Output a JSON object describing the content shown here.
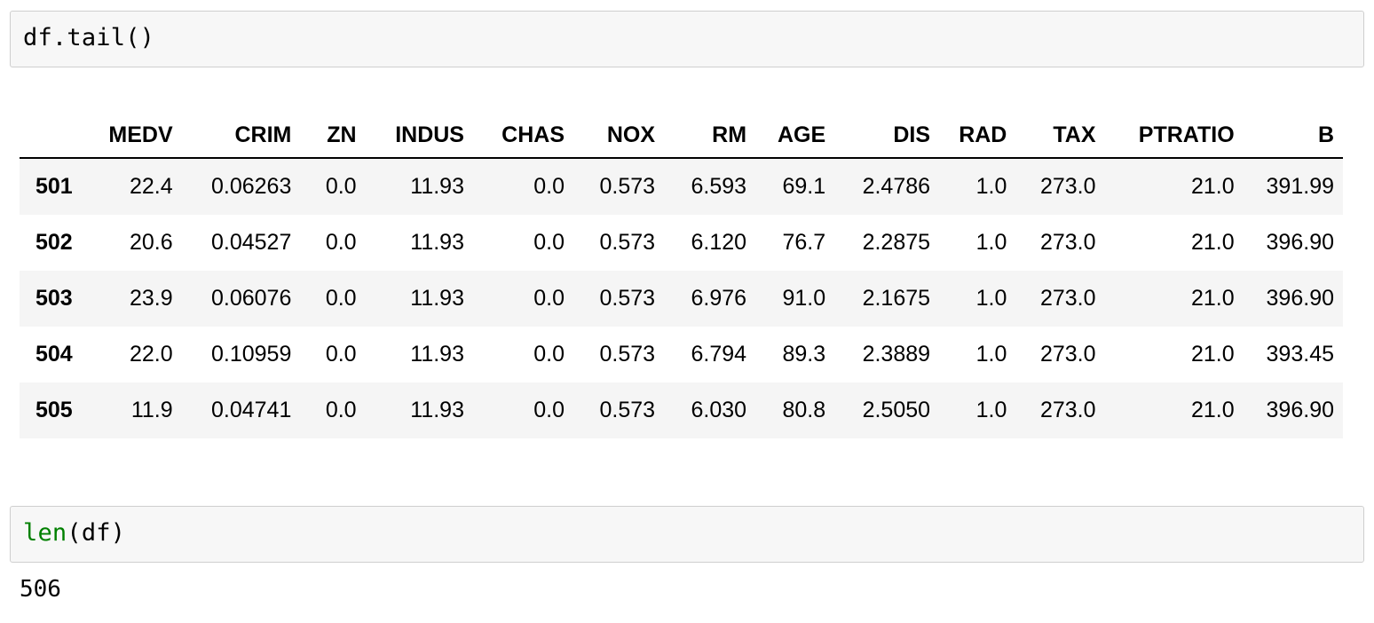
{
  "cells": [
    {
      "type": "code-input",
      "source_plain": "df.tail()",
      "tokens": [
        {
          "text": "df.tail()",
          "kind": "plain"
        }
      ]
    },
    {
      "type": "code-input",
      "source_plain": "len(df)",
      "tokens": [
        {
          "text": "len",
          "kind": "builtin"
        },
        {
          "text": "(df)",
          "kind": "plain"
        }
      ]
    }
  ],
  "dataframe": {
    "index_header": "",
    "columns": [
      "MEDV",
      "CRIM",
      "ZN",
      "INDUS",
      "CHAS",
      "NOX",
      "RM",
      "AGE",
      "DIS",
      "RAD",
      "TAX",
      "PTRATIO",
      "B"
    ],
    "index": [
      "501",
      "502",
      "503",
      "504",
      "505"
    ],
    "rows": [
      [
        "22.4",
        "0.06263",
        "0.0",
        "11.93",
        "0.0",
        "0.573",
        "6.593",
        "69.1",
        "2.4786",
        "1.0",
        "273.0",
        "21.0",
        "391.99"
      ],
      [
        "20.6",
        "0.04527",
        "0.0",
        "11.93",
        "0.0",
        "0.573",
        "6.120",
        "76.7",
        "2.2875",
        "1.0",
        "273.0",
        "21.0",
        "396.90"
      ],
      [
        "23.9",
        "0.06076",
        "0.0",
        "11.93",
        "0.0",
        "0.573",
        "6.976",
        "91.0",
        "2.1675",
        "1.0",
        "273.0",
        "21.0",
        "396.90"
      ],
      [
        "22.0",
        "0.10959",
        "0.0",
        "11.93",
        "0.0",
        "0.573",
        "6.794",
        "89.3",
        "2.3889",
        "1.0",
        "273.0",
        "21.0",
        "393.45"
      ],
      [
        "11.9",
        "0.04741",
        "0.0",
        "11.93",
        "0.0",
        "0.573",
        "6.030",
        "80.8",
        "2.5050",
        "1.0",
        "273.0",
        "21.0",
        "396.90"
      ]
    ]
  },
  "text_output": "506",
  "colors": {
    "cell_background": "#f7f7f7",
    "cell_border": "#cfcfcf",
    "row_stripe": "#f5f5f5",
    "builtin_token": "#008000",
    "text": "#000000",
    "header_rule": "#000000"
  }
}
